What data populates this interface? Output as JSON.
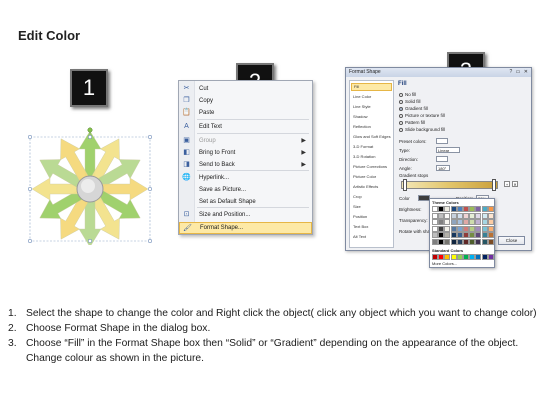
{
  "page_title": "Edit Color",
  "steps": [
    "1",
    "2",
    "3"
  ],
  "context_menu": {
    "items": [
      {
        "label": "Cut",
        "icon": "scissors-icon",
        "glyph": "✂",
        "disabled": false
      },
      {
        "label": "Copy",
        "icon": "copy-icon",
        "glyph": "❐",
        "disabled": false
      },
      {
        "label": "Paste",
        "icon": "paste-icon",
        "glyph": "📋",
        "disabled": false
      },
      {
        "label": "Edit Text",
        "icon": "edit-text-icon",
        "glyph": "A",
        "disabled": false
      },
      {
        "label": "Group",
        "icon": "group-icon",
        "glyph": "▣",
        "disabled": true,
        "submenu": true
      },
      {
        "label": "Bring to Front",
        "icon": "bring-front-icon",
        "glyph": "◧",
        "disabled": false,
        "submenu": true
      },
      {
        "label": "Send to Back",
        "icon": "send-back-icon",
        "glyph": "◨",
        "disabled": false,
        "submenu": true
      },
      {
        "label": "Hyperlink...",
        "icon": "hyperlink-icon",
        "glyph": "🌐",
        "disabled": false
      },
      {
        "label": "Save as Picture...",
        "icon": "",
        "glyph": "",
        "disabled": false
      },
      {
        "label": "Set as Default Shape",
        "icon": "",
        "glyph": "",
        "disabled": false
      },
      {
        "label": "Size and Position...",
        "icon": "size-position-icon",
        "glyph": "⊡",
        "disabled": false
      },
      {
        "label": "Format Shape...",
        "icon": "format-shape-icon",
        "glyph": "🖌",
        "disabled": false,
        "highlighted": true
      }
    ]
  },
  "format_dialog": {
    "title": "Format Shape",
    "window_controls": "? ▭ ✕",
    "nav_items": [
      "Fill",
      "Line Color",
      "Line Style",
      "Shadow",
      "Reflection",
      "Glow and Soft Edges",
      "3-D Format",
      "3-D Rotation",
      "Picture Corrections",
      "Picture Color",
      "Artistic Effects",
      "Crop",
      "Size",
      "Position",
      "Text Box",
      "Alt Text"
    ],
    "section_title": "Fill",
    "fill_options": [
      "No fill",
      "Solid fill",
      "Gradient fill",
      "Picture or texture fill",
      "Pattern fill",
      "Slide background fill"
    ],
    "selected_fill": "Gradient fill",
    "properties": {
      "preset_colors": "Preset colors:",
      "type_label": "Type:",
      "type_value": "Linear",
      "direction_label": "Direction:",
      "angle_label": "Angle:",
      "angle_value": "180°",
      "gradient_stops": "Gradient stops",
      "color_label": "Color",
      "position_label": "Position:",
      "position_value": "30%",
      "brightness_label": "Brightness:",
      "transparency_label": "Transparency:",
      "rotate_label": "Rotate with shape"
    },
    "palette": {
      "theme_title": "Theme Colors",
      "standard_title": "Standard Colors",
      "more": "More Colors...",
      "theme_colors": [
        "#ffffff",
        "#000000",
        "#eeece1",
        "#1f497d",
        "#4f81bd",
        "#c0504d",
        "#9bbb59",
        "#8064a2",
        "#4bacc6",
        "#f79646"
      ],
      "standard_colors": [
        "#c00000",
        "#ff0000",
        "#ffc000",
        "#ffff00",
        "#92d050",
        "#00b050",
        "#00b0f0",
        "#0070c0",
        "#002060",
        "#7030a0"
      ]
    },
    "close_label": "Close",
    "accent_color": "#e6b646"
  },
  "shape": {
    "arrow_colors": [
      "#9bcf66",
      "#f3e28a",
      "#b7d98f",
      "#f5d97a"
    ],
    "center_color": "#c8c8c8"
  },
  "instructions": [
    {
      "num": "1.",
      "text": "Select the shape to change the color and Right click the object( click any object which you want to change color)"
    },
    {
      "num": "2.",
      "text": "Choose Format Shape in the dialog box."
    },
    {
      "num": "3.",
      "text": "Choose “Fill” in the Format Shape box then “Solid” or “Gradient” depending on the appearance of the object. Change colour as shown in the picture."
    }
  ]
}
